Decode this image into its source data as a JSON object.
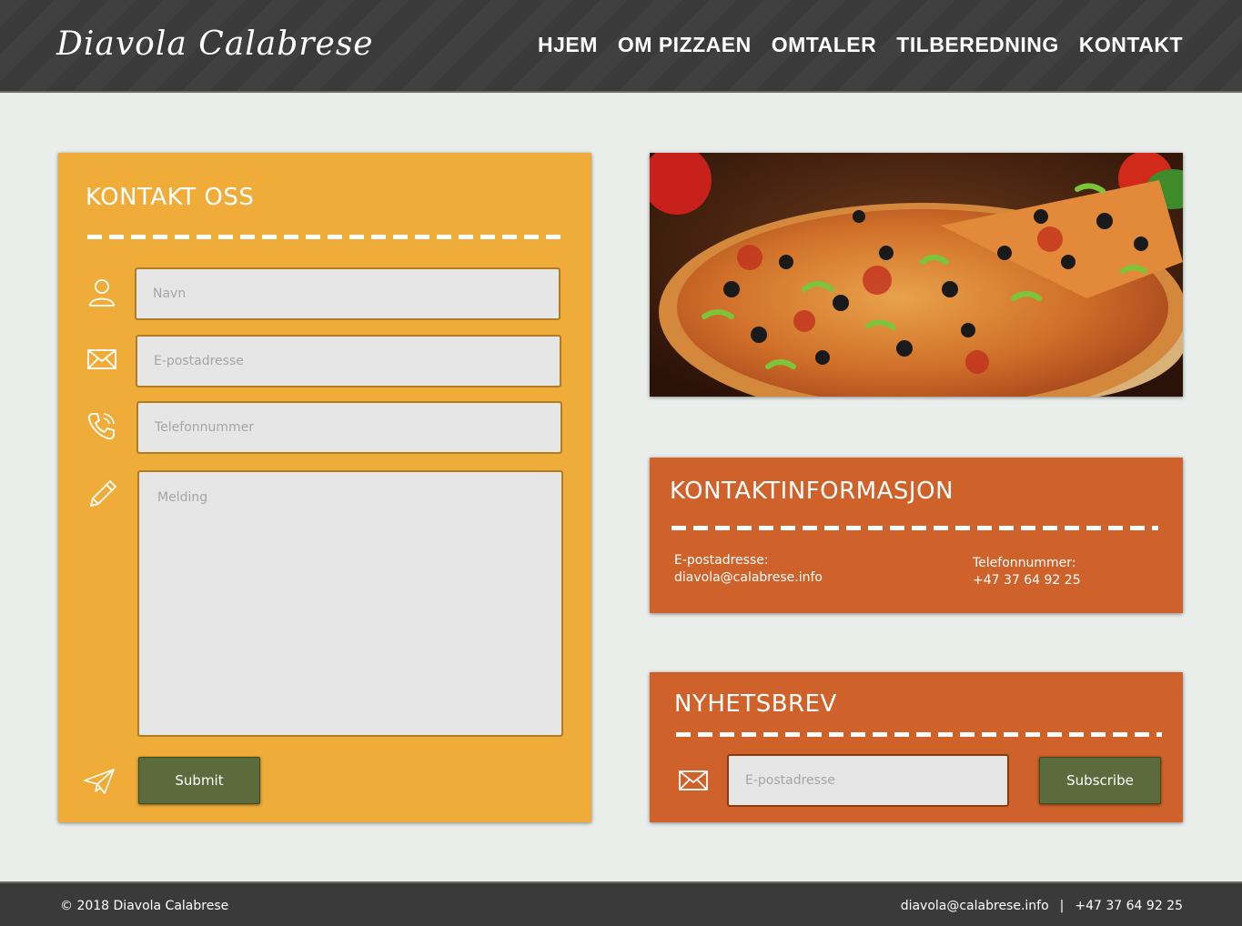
{
  "header": {
    "logo": "Diavola Calabrese",
    "nav": [
      "HJEM",
      "OM PIZZAEN",
      "OMTALER",
      "TILBEREDNING",
      "KONTAKT"
    ]
  },
  "contact_form": {
    "title": "KONTAKT OSS",
    "name_placeholder": "Navn",
    "email_placeholder": "E-postadresse",
    "phone_placeholder": "Telefonnummer",
    "message_placeholder": "Melding",
    "submit_label": "Submit"
  },
  "contact_info": {
    "title": "KONTAKTINFORMASJON",
    "email_label": "E-postadresse:",
    "email": "diavola@calabrese.info",
    "phone_label": "Telefonnummer:",
    "phone": "+47 37 64 92 25"
  },
  "newsletter": {
    "title": "NYHETSBREV",
    "email_placeholder": "E-postadresse",
    "subscribe_label": "Subscribe"
  },
  "footer": {
    "copyright": "© 2018 Diavola Calabrese",
    "email": "diavola@calabrese.info",
    "separator": "|",
    "phone": "+47 37 64 92 25"
  },
  "colors": {
    "header_bg": "#3a3a3a",
    "contact_card": "#efac38",
    "info_card": "#cf622a",
    "button": "#5b6b3b",
    "page_bg": "#eaeeeb"
  }
}
